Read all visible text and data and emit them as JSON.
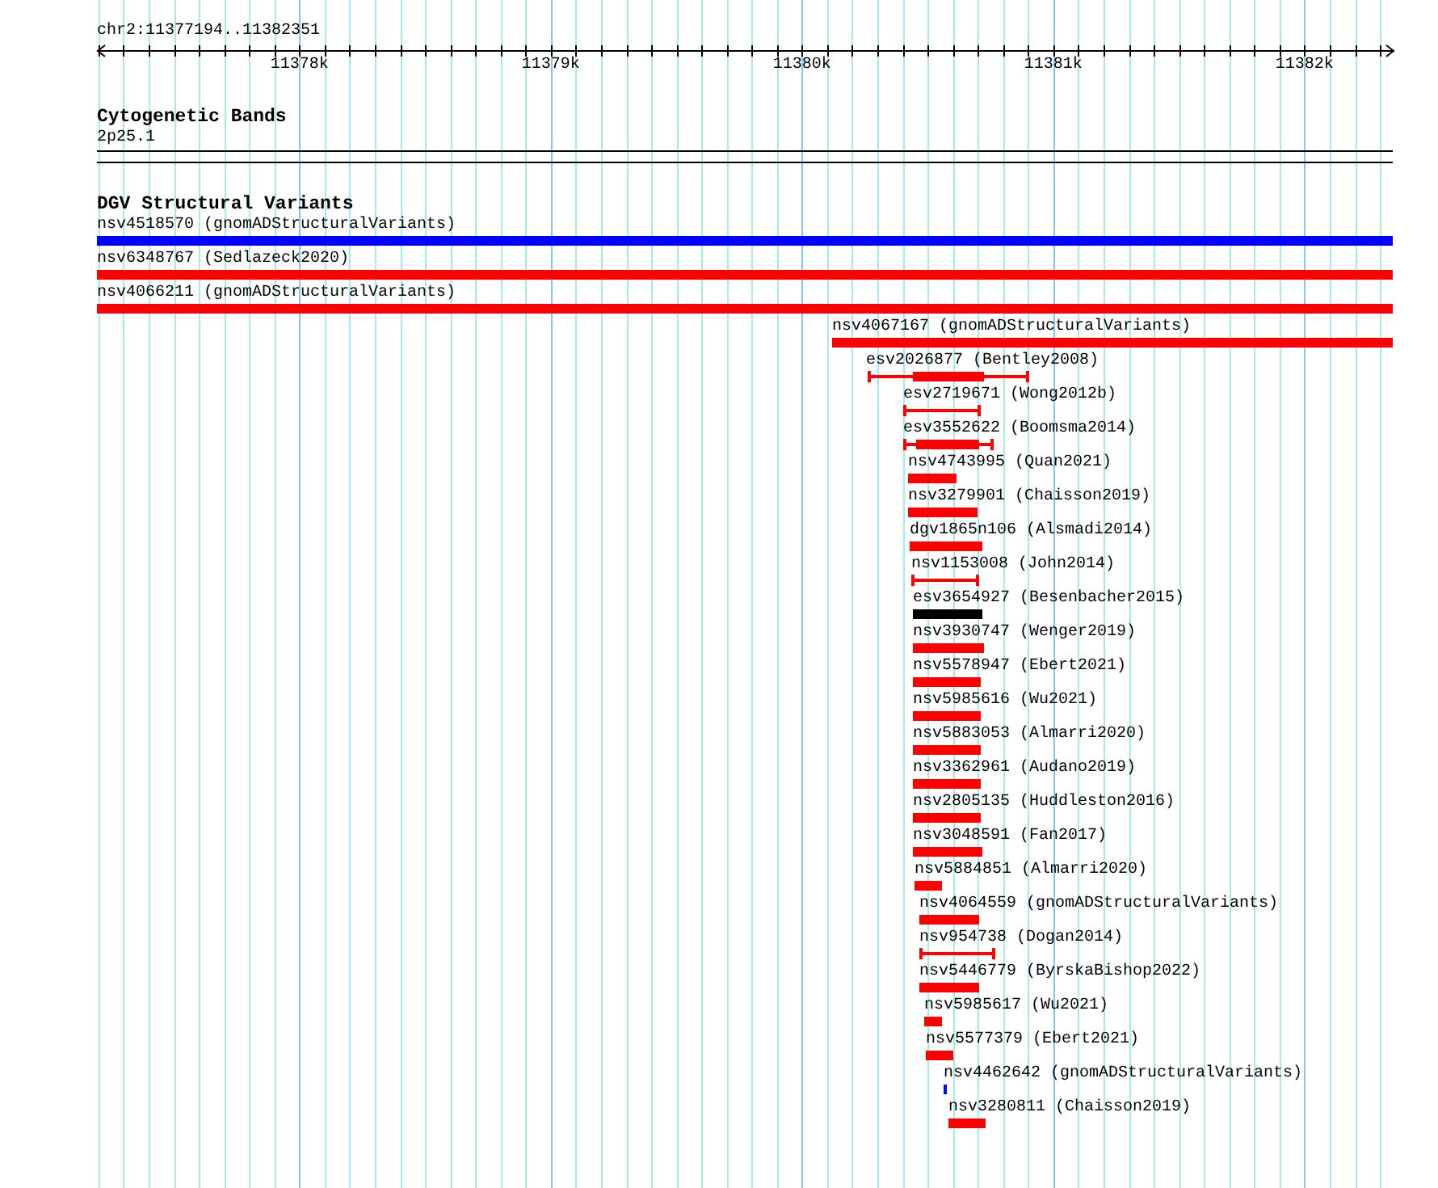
{
  "ruler": {
    "location": "chr2:11377194..11382351",
    "ticks": [
      "11378k",
      "11379k",
      "11380k",
      "11381k",
      "11382k"
    ]
  },
  "cytobands": {
    "title": "Cytogenetic Bands",
    "band": "2p25.1"
  },
  "variants": {
    "title": "DGV Structural Variants",
    "features": [
      {
        "label": "nsv4518570 (gnomADStructuralVariants)",
        "kind": "bar",
        "color": "#0000ff"
      },
      {
        "label": "nsv6348767 (Sedlazeck2020)",
        "kind": "bar",
        "color": "#ff0000"
      },
      {
        "label": "nsv4066211 (gnomADStructuralVariants)",
        "kind": "bar",
        "color": "#ff0000"
      },
      {
        "label": "nsv4067167 (gnomADStructuralVariants)",
        "kind": "bar",
        "color": "#ff0000"
      },
      {
        "label": "esv2026877 (Bentley2008)",
        "kind": "range_core",
        "color": "#ff0000"
      },
      {
        "label": "esv2719671 (Wong2012b)",
        "kind": "range",
        "color": "#ff0000"
      },
      {
        "label": "esv3552622 (Boomsma2014)",
        "kind": "range_core",
        "color": "#ff0000"
      },
      {
        "label": "nsv4743995 (Quan2021)",
        "kind": "bar",
        "color": "#ff0000"
      },
      {
        "label": "nsv3279901 (Chaisson2019)",
        "kind": "bar",
        "color": "#ff0000"
      },
      {
        "label": "dgv1865n106 (Alsmadi2014)",
        "kind": "bar",
        "color": "#ff0000"
      },
      {
        "label": "nsv1153008 (John2014)",
        "kind": "range",
        "color": "#ff0000"
      },
      {
        "label": "esv3654927 (Besenbacher2015)",
        "kind": "bar",
        "color": "#000000"
      },
      {
        "label": "nsv3930747 (Wenger2019)",
        "kind": "bar",
        "color": "#ff0000"
      },
      {
        "label": "nsv5578947 (Ebert2021)",
        "kind": "bar",
        "color": "#ff0000"
      },
      {
        "label": "nsv5985616 (Wu2021)",
        "kind": "bar",
        "color": "#ff0000"
      },
      {
        "label": "nsv5883053 (Almarri2020)",
        "kind": "bar",
        "color": "#ff0000"
      },
      {
        "label": "nsv3362961 (Audano2019)",
        "kind": "bar",
        "color": "#ff0000"
      },
      {
        "label": "nsv2805135 (Huddleston2016)",
        "kind": "bar",
        "color": "#ff0000"
      },
      {
        "label": "nsv3048591 (Fan2017)",
        "kind": "bar",
        "color": "#ff0000"
      },
      {
        "label": "nsv5884851 (Almarri2020)",
        "kind": "bar",
        "color": "#ff0000"
      },
      {
        "label": "nsv4064559 (gnomADStructuralVariants)",
        "kind": "bar",
        "color": "#ff0000"
      },
      {
        "label": "nsv954738 (Dogan2014)",
        "kind": "range",
        "color": "#ff0000"
      },
      {
        "label": "nsv5446779 (ByrskaBishop2022)",
        "kind": "bar",
        "color": "#ff0000"
      },
      {
        "label": "nsv5985617 (Wu2021)",
        "kind": "bar",
        "color": "#ff0000"
      },
      {
        "label": "nsv5577379 (Ebert2021)",
        "kind": "bar",
        "color": "#ff0000"
      },
      {
        "label": "nsv4462642 (gnomADStructuralVariants)",
        "kind": "bar",
        "color": "#0000ff"
      },
      {
        "label": "nsv3280811 (Chaisson2019)",
        "kind": "bar",
        "color": "#ff0000"
      }
    ]
  }
}
